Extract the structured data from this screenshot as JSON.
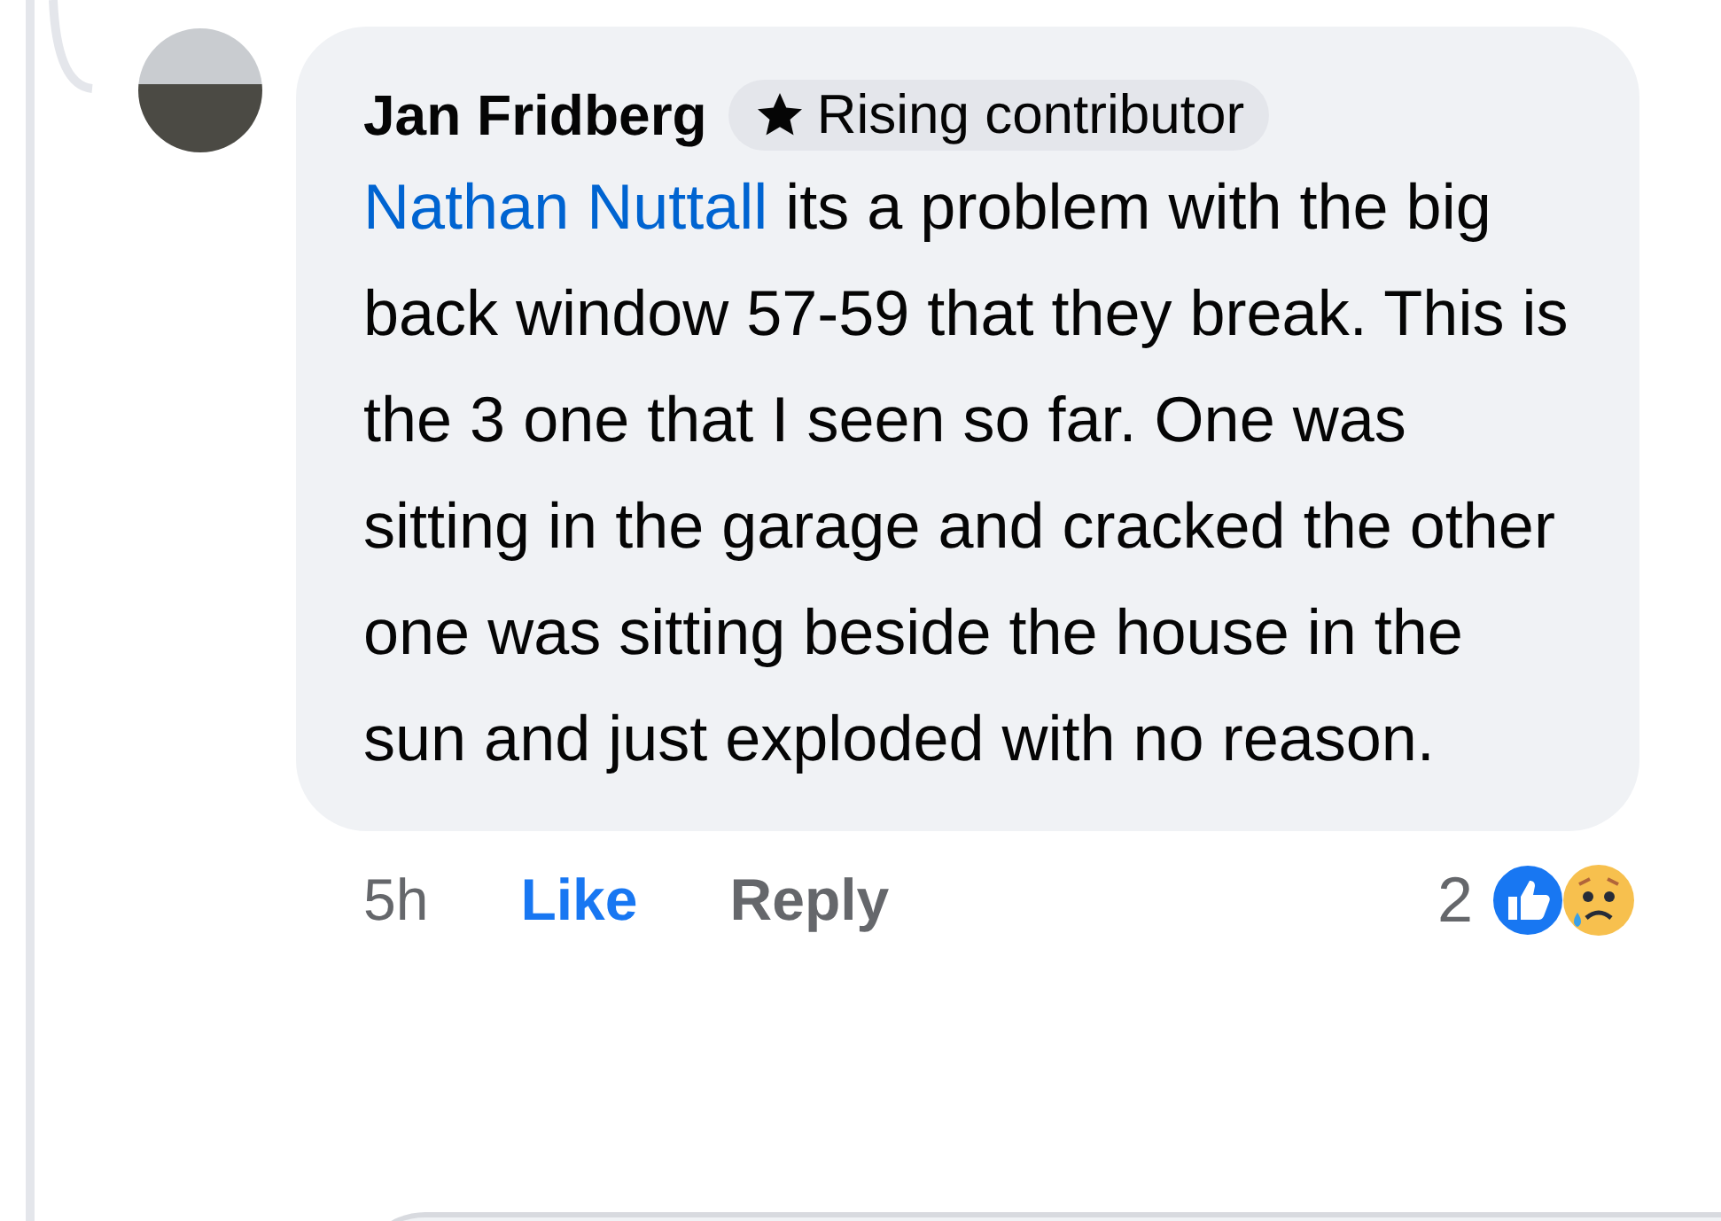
{
  "comment": {
    "author": "Jan Fridberg",
    "badge": "Rising contributor",
    "mention": "Nathan Nuttall",
    "text": " its a problem with the big back window 57-59 that they break. This is the 3 one that I seen so far. One was sitting in the garage and cracked the other one was sitting beside the house in the sun and just exploded with no reason.",
    "time": "5h",
    "like_label": "Like",
    "liked": true,
    "reply_label": "Reply",
    "reaction_count": "2"
  }
}
